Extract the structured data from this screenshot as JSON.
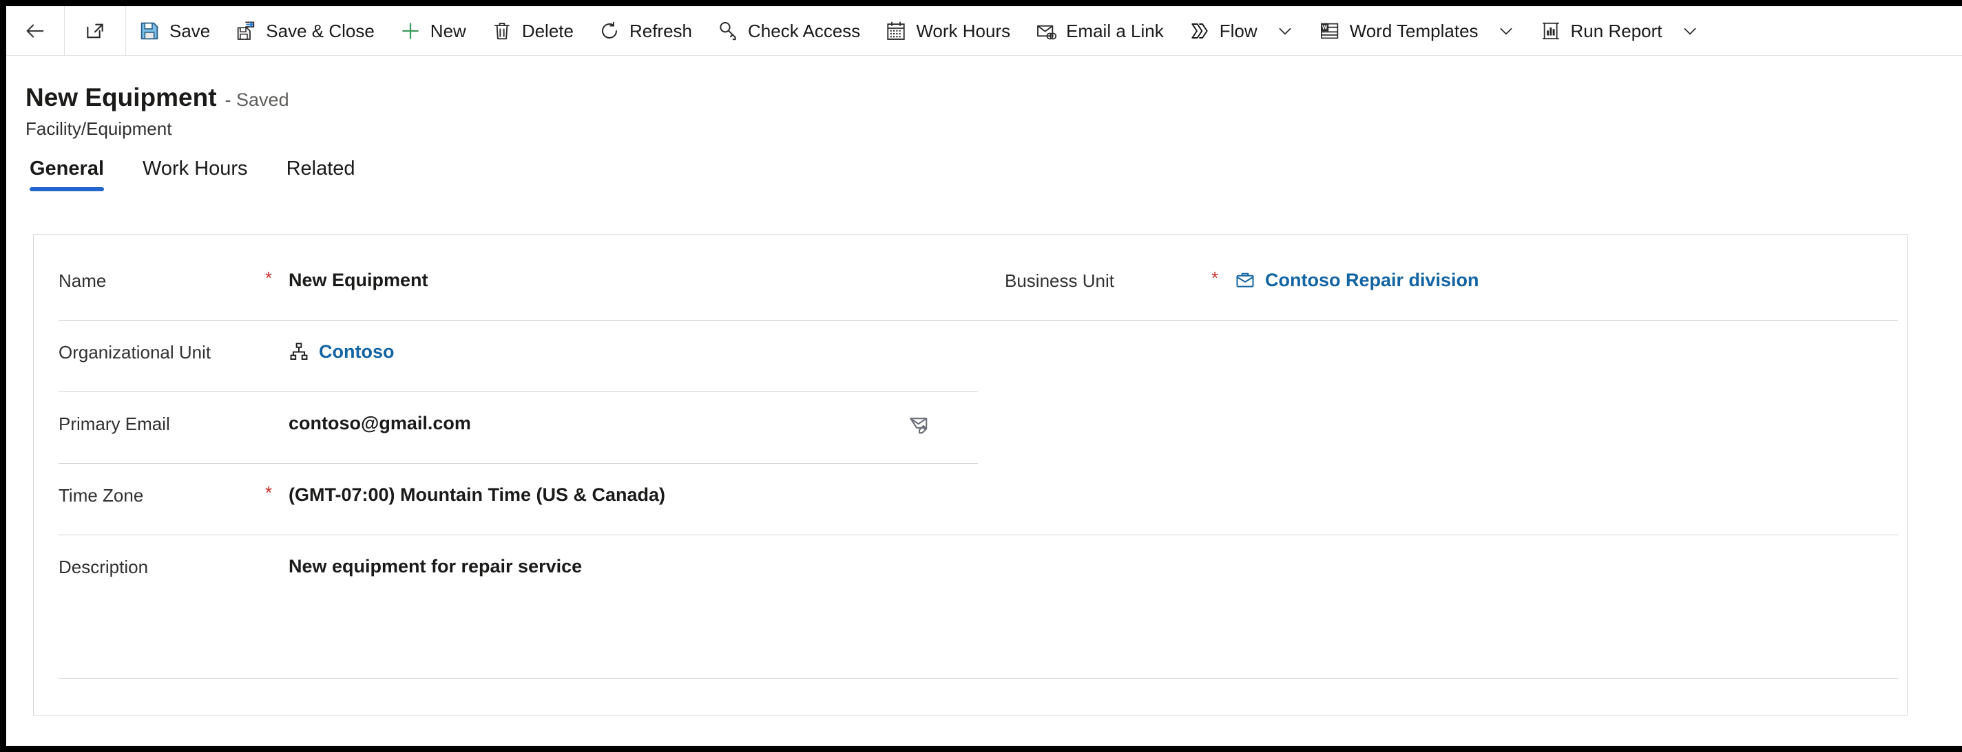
{
  "commandbar": {
    "back": {
      "label": "Back",
      "icon": "arrow-left-icon"
    },
    "popout": {
      "label": "Open in new window",
      "icon": "popout-icon"
    },
    "items": [
      {
        "id": "save",
        "label": "Save",
        "icon": "save-icon",
        "chevron": false
      },
      {
        "id": "save-and-close",
        "label": "Save & Close",
        "icon": "save-close-icon",
        "chevron": false
      },
      {
        "id": "new",
        "label": "New",
        "icon": "plus-icon",
        "chevron": false
      },
      {
        "id": "delete",
        "label": "Delete",
        "icon": "trash-icon",
        "chevron": false
      },
      {
        "id": "refresh",
        "label": "Refresh",
        "icon": "refresh-icon",
        "chevron": false
      },
      {
        "id": "check-access",
        "label": "Check Access",
        "icon": "key-icon",
        "chevron": false
      },
      {
        "id": "work-hours",
        "label": "Work Hours",
        "icon": "calendar-icon",
        "chevron": false
      },
      {
        "id": "email-a-link",
        "label": "Email a Link",
        "icon": "email-link-icon",
        "chevron": false
      },
      {
        "id": "flow",
        "label": "Flow",
        "icon": "flow-icon",
        "chevron": true
      },
      {
        "id": "word-templates",
        "label": "Word Templates",
        "icon": "word-icon",
        "chevron": true
      },
      {
        "id": "run-report",
        "label": "Run Report",
        "icon": "report-icon",
        "chevron": true
      }
    ]
  },
  "header": {
    "record_title": "New Equipment",
    "record_state": "- Saved",
    "entity_name": "Facility/Equipment"
  },
  "tabs": [
    {
      "id": "general",
      "label": "General",
      "active": true
    },
    {
      "id": "work-hours",
      "label": "Work Hours",
      "active": false
    },
    {
      "id": "related",
      "label": "Related",
      "active": false
    }
  ],
  "form": {
    "fields": {
      "name": {
        "label": "Name",
        "required": "*",
        "value": "New Equipment"
      },
      "business_unit": {
        "label": "Business Unit",
        "required": "*",
        "value": "Contoso Repair division",
        "icon": "briefcase-icon",
        "is_link": true
      },
      "organizational_unit": {
        "label": "Organizational Unit",
        "required": "",
        "value": "Contoso",
        "icon": "org-hierarchy-icon",
        "is_link": true
      },
      "primary_email": {
        "label": "Primary Email",
        "required": "",
        "value": "contoso@gmail.com",
        "action_icon": "compose-email-icon"
      },
      "time_zone": {
        "label": "Time Zone",
        "required": "*",
        "value": "(GMT-07:00) Mountain Time (US & Canada)"
      },
      "description": {
        "label": "Description",
        "required": "",
        "value": "New equipment for repair service"
      }
    }
  },
  "colors": {
    "accent": "#2266cc",
    "link": "#1264a3",
    "required": "#c63030",
    "save_icon": "#4a9bd4",
    "new_icon": "#3a9a5c",
    "divider": "#d2d2d2",
    "card_border": "#d8d8d8"
  }
}
